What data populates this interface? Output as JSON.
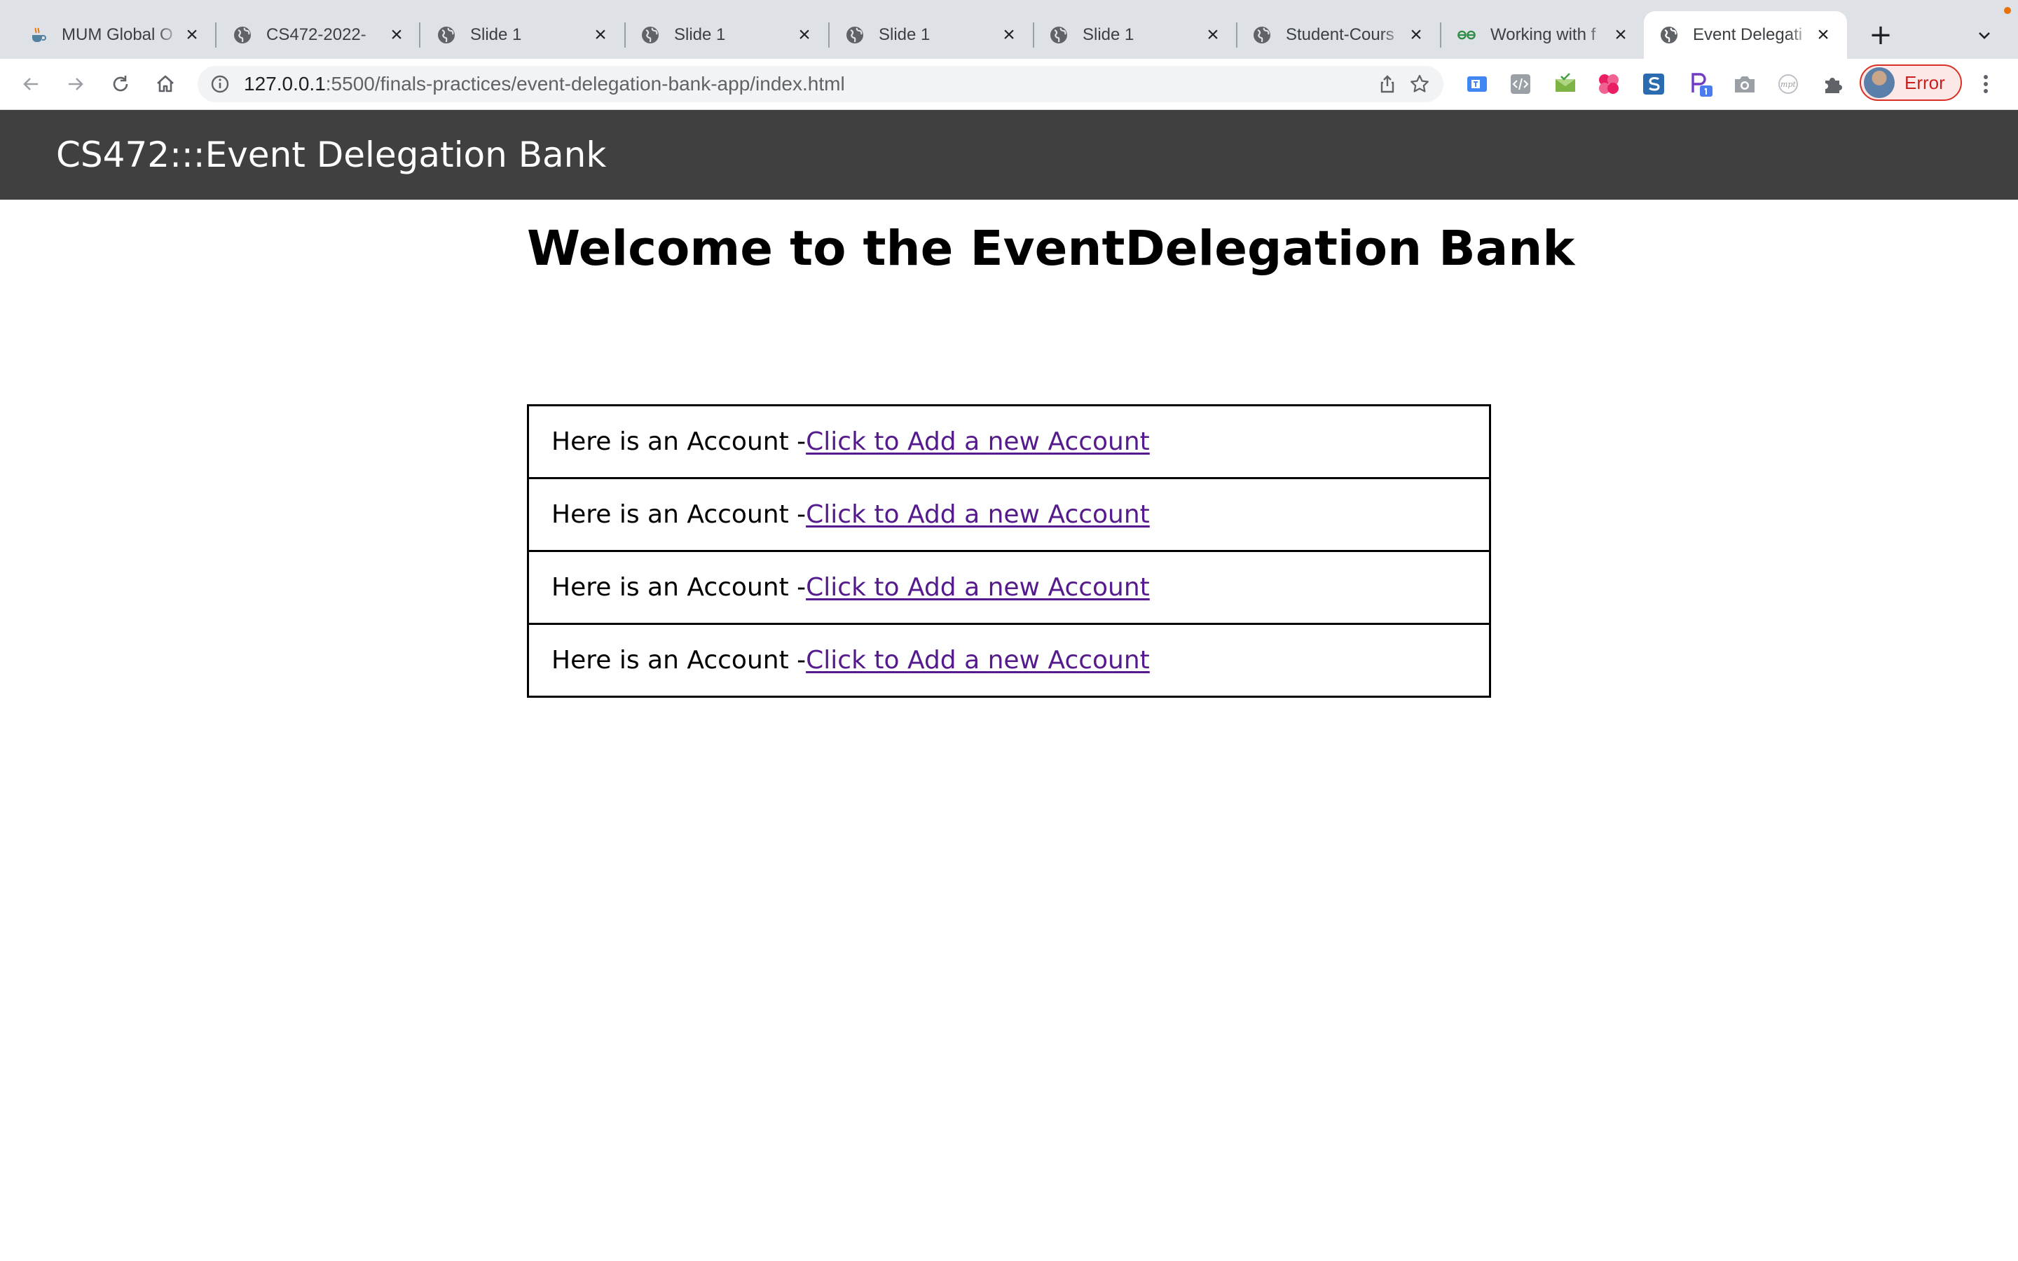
{
  "browser": {
    "tabs": [
      {
        "title": "MUM Global O",
        "favicon": "java-cup-icon",
        "active": false
      },
      {
        "title": "CS472-2022-",
        "favicon": "globe-icon",
        "active": false
      },
      {
        "title": "Slide 1",
        "favicon": "globe-icon",
        "active": false
      },
      {
        "title": "Slide 1",
        "favicon": "globe-icon",
        "active": false
      },
      {
        "title": "Slide 1",
        "favicon": "globe-icon",
        "active": false
      },
      {
        "title": "Slide 1",
        "favicon": "globe-icon",
        "active": false
      },
      {
        "title": "Student-Cours",
        "favicon": "globe-icon",
        "active": false
      },
      {
        "title": "Working with f",
        "favicon": "geeks-icon",
        "active": false
      },
      {
        "title": "Event Delegati",
        "favicon": "globe-icon",
        "active": true
      }
    ],
    "address": {
      "host": "127.0.0.1",
      "rest": ":5500/finals-practices/event-delegation-bank-app/index.html"
    },
    "profile": {
      "label": "Error"
    }
  },
  "site": {
    "brand": "CS472:::Event Delegation Bank"
  },
  "main": {
    "heading": "Welcome to the EventDelegation Bank",
    "accounts": [
      {
        "text": "Here is an Account - ",
        "link": "Click to Add a new Account"
      },
      {
        "text": "Here is an Account - ",
        "link": "Click to Add a new Account"
      },
      {
        "text": "Here is an Account - ",
        "link": "Click to Add a new Account"
      },
      {
        "text": "Here is an Account - ",
        "link": "Click to Add a new Account"
      }
    ]
  },
  "colors": {
    "header_bg": "#404040",
    "link_visited": "#551a8b",
    "profile_error": "#c5221f"
  }
}
